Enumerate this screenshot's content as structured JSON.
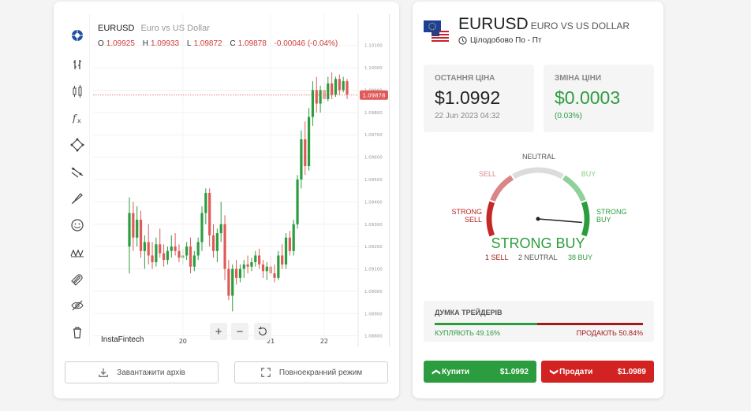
{
  "chart": {
    "symbol": "EURUSD",
    "description": "Euro vs US Dollar",
    "ohlc": {
      "o_label": "O",
      "o": "1.09925",
      "h_label": "H",
      "h": "1.09933",
      "l_label": "L",
      "l": "1.09872",
      "c_label": "C",
      "c": "1.09878",
      "change": "-0.00046 (-0.04%)"
    },
    "price_tag": "1.09878",
    "brand": "InstaFintech",
    "zoom_in": "+",
    "zoom_out": "−",
    "colors": {
      "up": "#2c9d3f",
      "down": "#e05a5a",
      "price_line": "#e05a5a"
    }
  },
  "chart_data": {
    "type": "candlestick",
    "title": "",
    "x_ticks": [
      "20",
      "21",
      "22"
    ],
    "y_ticks": [
      "1.10100",
      "1.10000",
      "1.09900",
      "1.09800",
      "1.09700",
      "1.09600",
      "1.09500",
      "1.09400",
      "1.09300",
      "1.09200",
      "1.09100",
      "1.09000",
      "1.08900",
      "1.08800"
    ],
    "ylim": [
      1.0876,
      1.1024
    ],
    "last_price": 1.09878,
    "candles_ohlc": [
      [
        1.092,
        1.0942,
        1.0908,
        1.0935
      ],
      [
        1.0935,
        1.094,
        1.0918,
        1.0924
      ],
      [
        1.0924,
        1.0938,
        1.092,
        1.0932
      ],
      [
        1.0932,
        1.0936,
        1.0915,
        1.0918
      ],
      [
        1.0918,
        1.0925,
        1.091,
        1.0922
      ],
      [
        1.0922,
        1.093,
        1.0912,
        1.0916
      ],
      [
        1.0916,
        1.0922,
        1.091,
        1.0913
      ],
      [
        1.0913,
        1.0924,
        1.0911,
        1.0921
      ],
      [
        1.0921,
        1.0928,
        1.0915,
        1.0917
      ],
      [
        1.0917,
        1.0921,
        1.0911,
        1.0914
      ],
      [
        1.0914,
        1.092,
        1.0912,
        1.0918
      ],
      [
        1.0918,
        1.0925,
        1.0915,
        1.092
      ],
      [
        1.092,
        1.0926,
        1.0916,
        1.0918
      ],
      [
        1.0918,
        1.0921,
        1.0913,
        1.0915
      ],
      [
        1.0915,
        1.0919,
        1.0912,
        1.0916
      ],
      [
        1.0916,
        1.0922,
        1.0914,
        1.092
      ],
      [
        1.092,
        1.0924,
        1.0908,
        1.0911
      ],
      [
        1.0911,
        1.0918,
        1.0909,
        1.0916
      ],
      [
        1.0916,
        1.0924,
        1.0914,
        1.0922
      ],
      [
        1.0922,
        1.0938,
        1.0918,
        1.0935
      ],
      [
        1.0935,
        1.0946,
        1.093,
        1.0944
      ],
      [
        1.0944,
        1.0946,
        1.092,
        1.0925
      ],
      [
        1.0925,
        1.093,
        1.0915,
        1.0918
      ],
      [
        1.0918,
        1.0928,
        1.0913,
        1.0926
      ],
      [
        1.0926,
        1.094,
        1.0922,
        1.093
      ],
      [
        1.093,
        1.0934,
        1.0905,
        1.091
      ],
      [
        1.091,
        1.0914,
        1.0896,
        1.0898
      ],
      [
        1.0898,
        1.0912,
        1.0891,
        1.091
      ],
      [
        1.091,
        1.0914,
        1.0903,
        1.0906
      ],
      [
        1.0906,
        1.0912,
        1.0904,
        1.091
      ],
      [
        1.091,
        1.0914,
        1.0906,
        1.0912
      ],
      [
        1.0912,
        1.0916,
        1.0908,
        1.0911
      ],
      [
        1.0911,
        1.0915,
        1.0909,
        1.0913
      ],
      [
        1.0913,
        1.0918,
        1.0911,
        1.0916
      ],
      [
        1.0916,
        1.0919,
        1.091,
        1.0912
      ],
      [
        1.0912,
        1.0914,
        1.0906,
        1.0909
      ],
      [
        1.0909,
        1.0913,
        1.0905,
        1.0911
      ],
      [
        1.0911,
        1.0916,
        1.0907,
        1.0908
      ],
      [
        1.0908,
        1.0912,
        1.0904,
        1.0906
      ],
      [
        1.0906,
        1.0918,
        1.0905,
        1.0916
      ],
      [
        1.0916,
        1.0921,
        1.091,
        1.0912
      ],
      [
        1.0912,
        1.0926,
        1.091,
        1.0924
      ],
      [
        1.0924,
        1.0927,
        1.0916,
        1.0918
      ],
      [
        1.0918,
        1.0932,
        1.0916,
        1.093
      ],
      [
        1.093,
        1.0952,
        1.0928,
        1.095
      ],
      [
        1.095,
        1.0972,
        1.0946,
        1.0968
      ],
      [
        1.0968,
        1.0976,
        1.0952,
        1.0956
      ],
      [
        1.0956,
        1.0982,
        1.0954,
        1.0978
      ],
      [
        1.0978,
        1.0994,
        1.0974,
        1.099
      ],
      [
        1.099,
        1.0996,
        1.098,
        1.0984
      ],
      [
        1.0984,
        1.0992,
        1.098,
        1.099
      ],
      [
        1.099,
        1.0994,
        1.0984,
        1.0986
      ],
      [
        1.0986,
        1.0996,
        1.0985,
        1.0993
      ],
      [
        1.0993,
        1.0998,
        1.0986,
        1.0988
      ],
      [
        1.0988,
        1.0996,
        1.0987,
        1.0995
      ],
      [
        1.0995,
        1.0997,
        1.0988,
        1.099
      ],
      [
        1.099,
        1.0996,
        1.0989,
        1.0994
      ],
      [
        1.0994,
        1.0995,
        1.0986,
        1.0988
      ]
    ]
  },
  "actions": {
    "download_label": "Завантажити архів",
    "fullscreen_label": "Повноекранний режим"
  },
  "instrument": {
    "symbol": "EURUSD",
    "description": "EURO VS US DOLLAR",
    "schedule": "Цілодобово По - Пт"
  },
  "last_price": {
    "label": "ОСТАННЯ ЦІНА",
    "value": "$1.0992",
    "date": "22 Jun 2023 04:32"
  },
  "price_change": {
    "label": "ЗМІНА ЦІНИ",
    "value": "$0.0003",
    "percent": "(0.03%)"
  },
  "gauge": {
    "neutral": "NEUTRAL",
    "sell": "SELL",
    "buy": "BUY",
    "strong_sell_1": "STRONG",
    "strong_sell_2": "SELL",
    "strong_buy_1": "STRONG",
    "strong_buy_2": "BUY",
    "verdict": "STRONG BUY",
    "sell_count": "1 SELL",
    "neutral_count": "2 NEUTRAL",
    "buy_count": "38 BUY",
    "needle_fraction": 0.93
  },
  "sentiment": {
    "title": "ДУМКА ТРЕЙДЕРІВ",
    "buy_text": "КУПЛЯЮТЬ 49.16%",
    "sell_text": "ПРОДАЮТЬ 50.84%",
    "buy_pct": 49.16,
    "sell_pct": 50.84
  },
  "trade": {
    "buy_label": "Купити",
    "buy_price": "$1.0992",
    "sell_label": "Продати",
    "sell_price": "$1.0989",
    "buy_color": "#2c9d3f",
    "sell_color": "#d32222"
  },
  "toolbar_icons": [
    "crosshair-icon",
    "bar-style-icon",
    "candles-icon",
    "indicator-fx-icon",
    "shapes-icon",
    "trend-line-icon",
    "brush-icon",
    "emoji-icon",
    "pattern-icon",
    "magnet-icon",
    "hide-icon",
    "trash-icon"
  ]
}
